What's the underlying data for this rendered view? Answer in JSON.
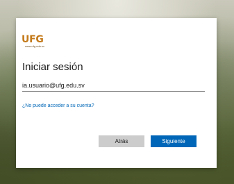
{
  "logo": {
    "text": "UFG",
    "tagline": "www.ufg.edu.sv"
  },
  "signin": {
    "title": "Iniciar sesión",
    "email_value": "ia.usuario@ufg.edu.sv",
    "forgot_link": "¿No puede acceder a su cuenta?"
  },
  "buttons": {
    "back_label": "Atrás",
    "next_label": "Siguiente"
  },
  "colors": {
    "accent": "#0067b8",
    "logo": "#c47a1a",
    "secondary_button": "#cccccc"
  }
}
